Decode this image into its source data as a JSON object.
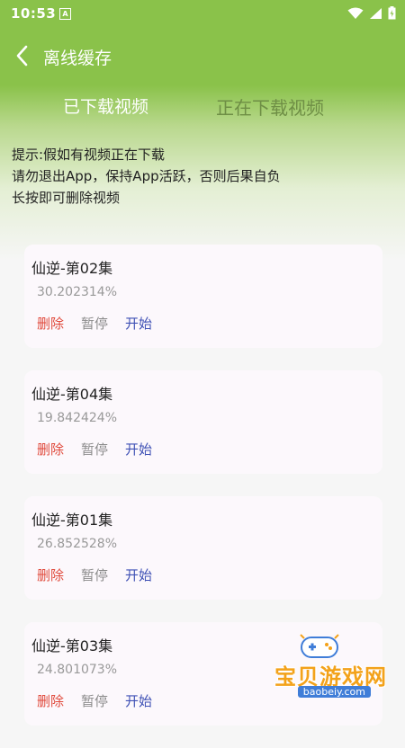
{
  "status_bar": {
    "time": "10:53",
    "notification_glyph": "A",
    "icons": [
      "wifi-icon",
      "signal-icon",
      "battery-icon"
    ]
  },
  "header": {
    "title": "离线缓存"
  },
  "tabs": [
    {
      "label": "已下载视频",
      "active": true
    },
    {
      "label": "正在下载视频",
      "active": false
    }
  ],
  "notice": {
    "line1": "提示:假如有视频正在下载",
    "line2": "请勿退出App，保持App活跃，否则后果自负",
    "line3": "长按即可删除视频"
  },
  "downloads": [
    {
      "title": "仙逆-第02集",
      "progress": "30.202314%",
      "delete_label": "删除",
      "pause_label": "暂停",
      "start_label": "开始"
    },
    {
      "title": "仙逆-第04集",
      "progress": "19.842424%",
      "delete_label": "删除",
      "pause_label": "暂停",
      "start_label": "开始"
    },
    {
      "title": "仙逆-第01集",
      "progress": "26.852528%",
      "delete_label": "删除",
      "pause_label": "暂停",
      "start_label": "开始"
    },
    {
      "title": "仙逆-第03集",
      "progress": "24.801073%",
      "delete_label": "删除",
      "pause_label": "暂停",
      "start_label": "开始"
    }
  ],
  "watermark": {
    "name": "宝贝游戏网",
    "url": "baobeiy.com"
  },
  "colors": {
    "header_green": "#8ac24a",
    "delete": "#e04a3c",
    "pause": "#8c8c8c",
    "start": "#3f51b5",
    "card_bg": "#fcf8fc"
  }
}
